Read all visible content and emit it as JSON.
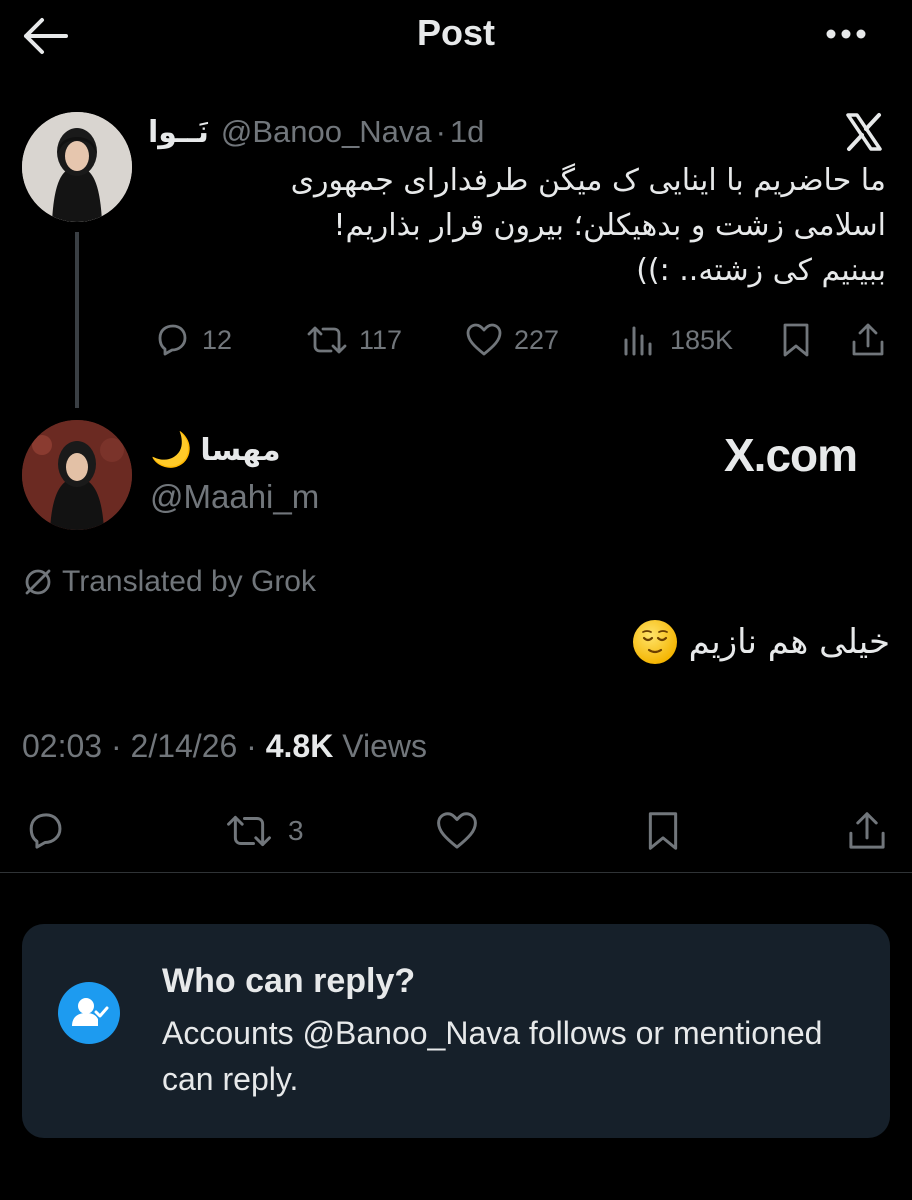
{
  "header": {
    "title": "Post"
  },
  "parent_post": {
    "author_name": "نَــوا",
    "handle": "@Banoo_Nava",
    "separator": "·",
    "age": "1d",
    "text_lines": [
      "ما حاضریم با اینایی ک میگن طرفدارای جمهوری",
      "اسلامی زشت و بدهیکلن؛ بیرون قرار بذاریم!",
      "ببینیم کی زشته.. :))"
    ],
    "actions": {
      "replies": "12",
      "reposts": "117",
      "likes": "227",
      "views": "185K"
    }
  },
  "reply_post": {
    "author_name": "مهسا",
    "author_emoji": "🌙",
    "handle": "@Maahi_m",
    "watermark": "X.com",
    "translated_label": "Translated by Grok",
    "text": "خیلی هم نازیم",
    "time": "02:03",
    "date": "2/14/26",
    "views_count": "4.8K",
    "views_label": "Views",
    "actions": {
      "reposts": "3"
    }
  },
  "who_can_reply": {
    "title": "Who can reply?",
    "description": "Accounts @Banoo_Nava follows or mentioned can reply."
  },
  "colors": {
    "background": "#000000",
    "text_primary": "#e7e9ea",
    "text_secondary": "#71767b",
    "accent": "#1d9bf0",
    "card": "#16202a"
  },
  "icons": [
    "back-arrow-icon",
    "more-icon",
    "x-logo-icon",
    "reply-icon",
    "repost-icon",
    "like-icon",
    "views-icon",
    "bookmark-icon",
    "share-icon",
    "translate-icon",
    "user-check-icon"
  ]
}
